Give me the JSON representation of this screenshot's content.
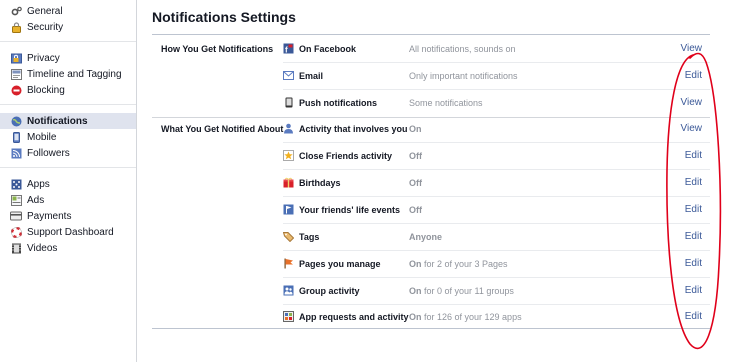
{
  "sidebar": {
    "groups": [
      [
        {
          "label": "General",
          "icon": "gear-icon"
        },
        {
          "label": "Security",
          "icon": "lock-icon"
        }
      ],
      [
        {
          "label": "Privacy",
          "icon": "padlock-people-icon"
        },
        {
          "label": "Timeline and Tagging",
          "icon": "timeline-icon"
        },
        {
          "label": "Blocking",
          "icon": "block-icon"
        }
      ],
      [
        {
          "label": "Notifications",
          "icon": "globe-icon",
          "active": true
        },
        {
          "label": "Mobile",
          "icon": "mobile-icon"
        },
        {
          "label": "Followers",
          "icon": "rss-icon"
        }
      ],
      [
        {
          "label": "Apps",
          "icon": "apps-icon"
        },
        {
          "label": "Ads",
          "icon": "ads-icon"
        },
        {
          "label": "Payments",
          "icon": "card-icon"
        },
        {
          "label": "Support Dashboard",
          "icon": "lifebuoy-icon"
        },
        {
          "label": "Videos",
          "icon": "film-icon"
        }
      ]
    ]
  },
  "main": {
    "title": "Notifications Settings",
    "sections": [
      {
        "label": "How You Get Notifications",
        "rows": [
          {
            "name": "On Facebook",
            "icon": "facebook-flag-icon",
            "status_bold": "",
            "status": "All notifications, sounds on",
            "action": "View"
          },
          {
            "name": "Email",
            "icon": "envelope-icon",
            "status_bold": "",
            "status": "Only important notifications",
            "action": "Edit"
          },
          {
            "name": "Push notifications",
            "icon": "phone-icon",
            "status_bold": "",
            "status": "Some notifications",
            "action": "View"
          }
        ]
      },
      {
        "label": "What You Get Notified About",
        "rows": [
          {
            "name": "Activity that involves you",
            "icon": "person-icon",
            "status_bold": "On",
            "status": "",
            "action": "View"
          },
          {
            "name": "Close Friends activity",
            "icon": "star-icon",
            "status_bold": "Off",
            "status": "",
            "action": "Edit"
          },
          {
            "name": "Birthdays",
            "icon": "gift-icon",
            "status_bold": "Off",
            "status": "",
            "action": "Edit"
          },
          {
            "name": "Your friends' life events",
            "icon": "flag-icon",
            "status_bold": "Off",
            "status": "",
            "action": "Edit"
          },
          {
            "name": "Tags",
            "icon": "tag-icon",
            "status_bold": "Anyone",
            "status": "",
            "action": "Edit"
          },
          {
            "name": "Pages you manage",
            "icon": "pages-flag-icon",
            "status_bold": "On",
            "status": " for 2 of your 3 Pages",
            "action": "Edit"
          },
          {
            "name": "Group activity",
            "icon": "group-icon",
            "status_bold": "On",
            "status": " for 0 of your 11 groups",
            "action": "Edit"
          },
          {
            "name": "App requests and activity",
            "icon": "app-icon",
            "status_bold": "On",
            "status": " for 126 of your 129 apps",
            "action": "Edit"
          }
        ]
      }
    ]
  },
  "colors": {
    "link": "#3b5998",
    "active_bg": "#dfe3ee",
    "annotation": "#e0001a"
  }
}
